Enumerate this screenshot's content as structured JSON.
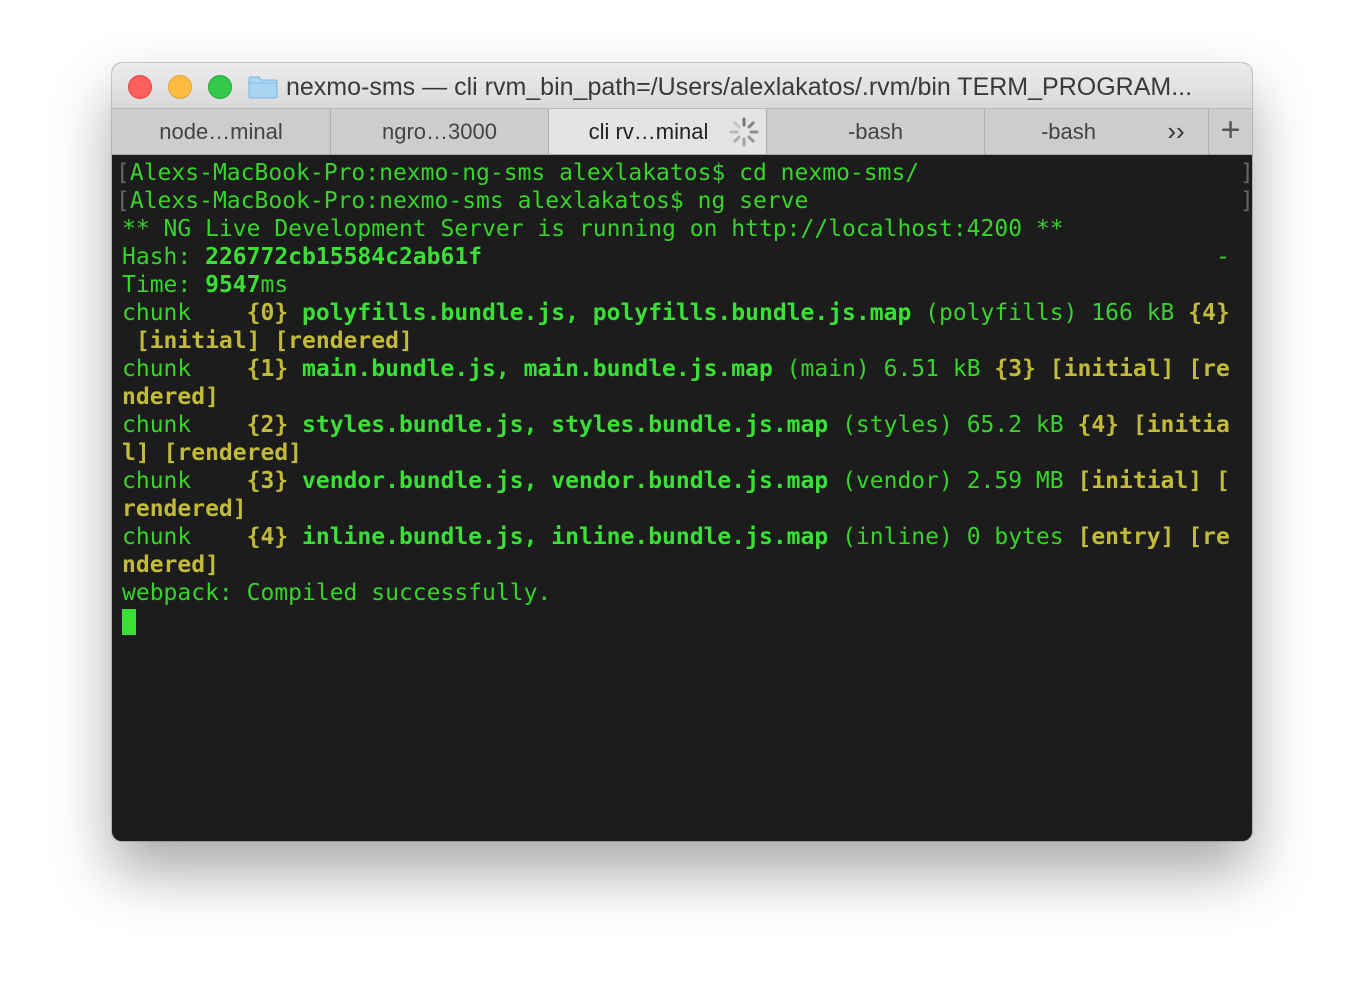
{
  "window": {
    "title": "nexmo-sms — cli rvm_bin_path=/Users/alexlakatos/.rvm/bin TERM_PROGRAM...",
    "folder_icon": "folder-icon"
  },
  "tabs": [
    {
      "label": "node…minal",
      "active": false
    },
    {
      "label": "ngro…3000",
      "active": false
    },
    {
      "label": "cli rv…minal",
      "active": true,
      "busy_icon": "spinner-icon"
    },
    {
      "label": "-bash",
      "active": false
    },
    {
      "label": "-bash",
      "active": false
    }
  ],
  "tab_overflow_label": "››",
  "new_tab_label": "+",
  "terminal": {
    "prompt1": {
      "bracket": "[",
      "host": "Alexs-MacBook-Pro:nexmo-ng-sms alexlakatos$",
      "cmd": " cd nexmo-sms/"
    },
    "prompt2": {
      "bracket": "[",
      "host": "Alexs-MacBook-Pro:nexmo-sms alexlakatos$",
      "cmd": " ng serve"
    },
    "ng_line": "** NG Live Development Server is running on http://localhost:4200 **",
    "hash_label": "Hash: ",
    "hash_value": "226772cb15584c2ab61f",
    "time_label": "Time: ",
    "time_value": "9547",
    "time_unit": "ms",
    "chunks": [
      {
        "label": "chunk    ",
        "id": "{0}",
        "files": " polyfills.bundle.js, polyfills.bundle.js.map",
        "meta": " (polyfills) 166 kB ",
        "parents": "{4}",
        "wrap_pre": "",
        "flags1": " [initial] [rendered]",
        "flags2": ""
      },
      {
        "label": "chunk    ",
        "id": "{1}",
        "files": " main.bundle.js, main.bundle.js.map",
        "meta": " (main) 6.51 kB ",
        "parents": "{3}",
        "flags_line1": " [initial] [re",
        "flags_line2": "ndered]"
      },
      {
        "label": "chunk    ",
        "id": "{2}",
        "files": " styles.bundle.js, styles.bundle.js.map",
        "meta": " (styles) 65.2 kB ",
        "parents": "{4}",
        "flags_line1": " [initia",
        "flags_line2": "l] [rendered]"
      },
      {
        "label": "chunk    ",
        "id": "{3}",
        "files": " vendor.bundle.js, vendor.bundle.js.map",
        "meta": " (vendor) 2.59 MB ",
        "flags_line1": "[initial] [",
        "flags_line2": "rendered]"
      },
      {
        "label": "chunk    ",
        "id": "{4}",
        "files": " inline.bundle.js, inline.bundle.js.map",
        "meta": " (inline) 0 bytes ",
        "flags_line1": "[entry] [re",
        "flags_line2": "ndered]"
      }
    ],
    "webpack_line": "webpack: Compiled successfully.",
    "edge_bracket": "]",
    "edge_dash": "-"
  },
  "colors": {
    "green": "#38d32c",
    "bright_green": "#3ae036",
    "yellow": "#c2ba3a",
    "background": "#1c1c1c"
  }
}
